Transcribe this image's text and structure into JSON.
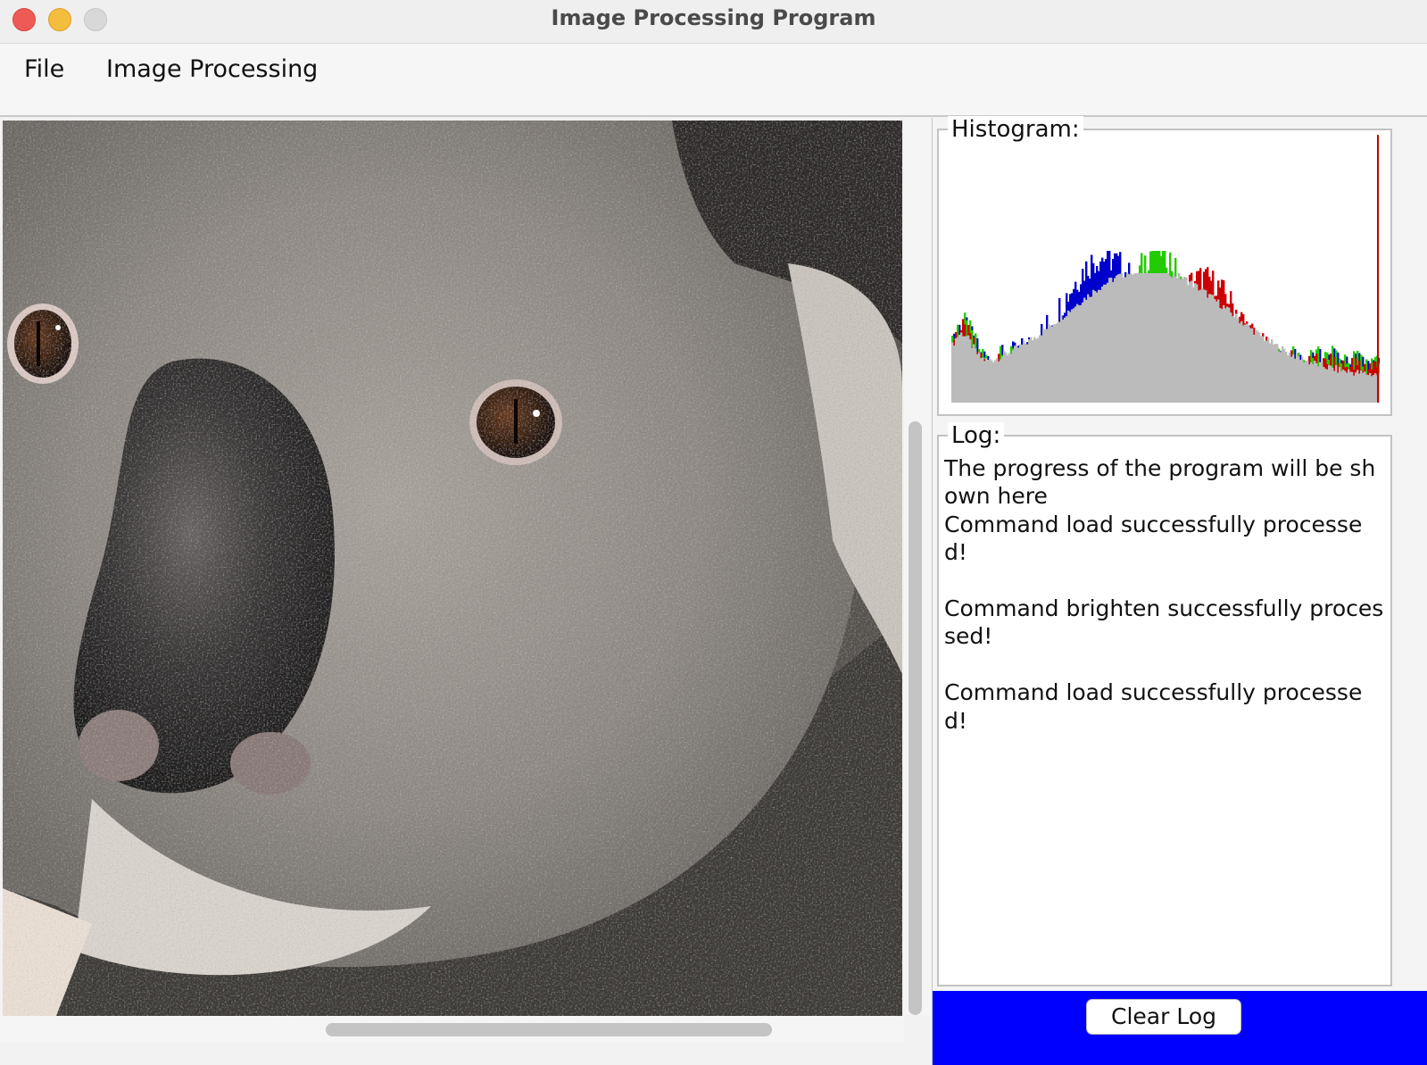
{
  "window": {
    "title": "Image Processing Program"
  },
  "menubar": {
    "items": [
      {
        "label": "File"
      },
      {
        "label": "Image Processing"
      }
    ]
  },
  "image": {
    "subject": "koala-face-photo"
  },
  "histogram": {
    "label": "Histogram:"
  },
  "log": {
    "label": "Log:",
    "text": "The progress of the program will be shown here\nCommand load successfully processed!\n\nCommand brighten successfully processed!\n\nCommand load successfully processed!",
    "clear_label": "Clear Log"
  },
  "colors": {
    "accent_bar": "#0000ff",
    "hist_red": "#cc0000",
    "hist_green": "#22cc00",
    "hist_blue": "#0000cc",
    "hist_gray": "#bbbbbb"
  }
}
